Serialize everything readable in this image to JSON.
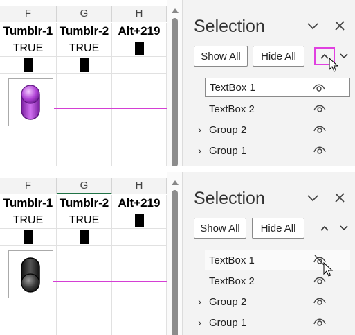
{
  "screens": [
    {
      "columns": [
        {
          "letter": "F",
          "header": "Tumblr-1",
          "value": "TRUE"
        },
        {
          "letter": "G",
          "header": "Tumblr-2",
          "value": "TRUE"
        },
        {
          "letter": "H",
          "header": "Alt+219",
          "value": ""
        }
      ],
      "toggle_state": "on",
      "toggle_color": "#b043d6",
      "pane": {
        "title": "Selection",
        "show_all": "Show All",
        "hide_all": "Hide All",
        "items": [
          {
            "label": "TextBox 1",
            "expandable": false,
            "visible": true,
            "state": "selected"
          },
          {
            "label": "TextBox 2",
            "expandable": false,
            "visible": true,
            "state": "normal"
          },
          {
            "label": "Group 2",
            "expandable": true,
            "visible": true,
            "state": "normal"
          },
          {
            "label": "Group 1",
            "expandable": true,
            "visible": true,
            "state": "normal"
          }
        ]
      }
    },
    {
      "columns": [
        {
          "letter": "F",
          "header": "Tumblr-1",
          "value": "TRUE"
        },
        {
          "letter": "G",
          "header": "Tumblr-2",
          "value": "TRUE"
        },
        {
          "letter": "H",
          "header": "Alt+219",
          "value": ""
        }
      ],
      "toggle_state": "off",
      "toggle_color": "#3a3a3a",
      "pane": {
        "title": "Selection",
        "show_all": "Show All",
        "hide_all": "Hide All",
        "items": [
          {
            "label": "TextBox 1",
            "expandable": false,
            "visible": false,
            "state": "hover"
          },
          {
            "label": "TextBox 2",
            "expandable": false,
            "visible": true,
            "state": "normal"
          },
          {
            "label": "Group 2",
            "expandable": true,
            "visible": true,
            "state": "normal"
          },
          {
            "label": "Group 1",
            "expandable": true,
            "visible": true,
            "state": "normal"
          }
        ]
      }
    }
  ],
  "colors": {
    "accent_highlight": "#e040e0",
    "connector": "#d43fd4",
    "excel_green": "#217346"
  }
}
